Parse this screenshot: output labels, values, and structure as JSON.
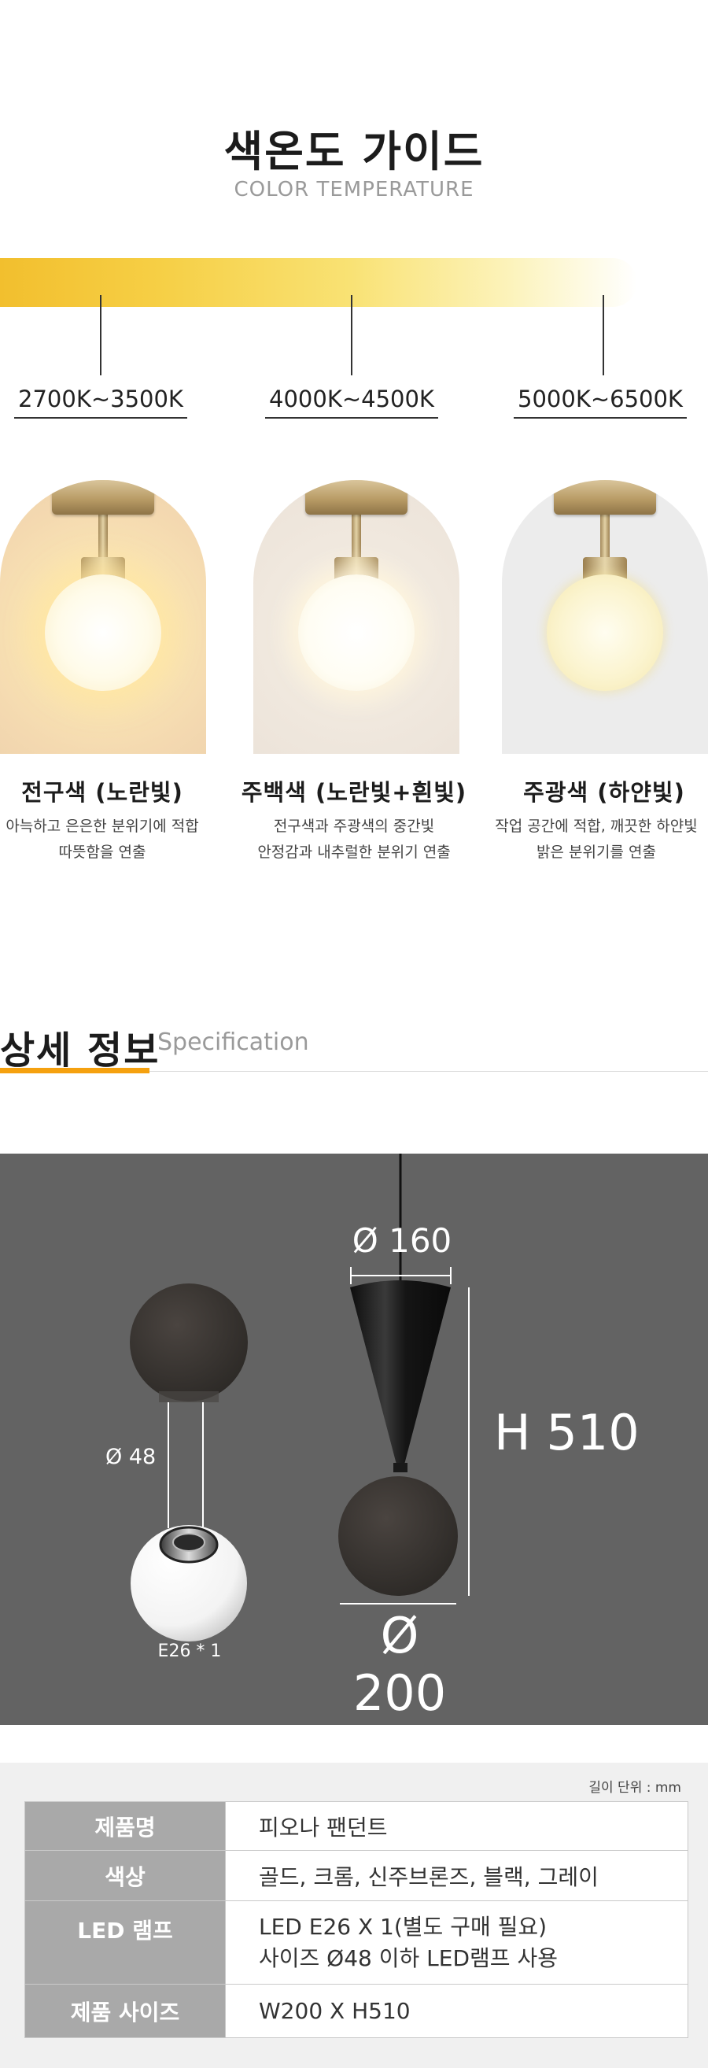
{
  "guide": {
    "title": "색온도 가이드",
    "subtitle": "COLOR TEMPERATURE",
    "ranges": [
      "2700K~3500K",
      "4000K~4500K",
      "5000K~6500K"
    ],
    "lamps": [
      {
        "name": "전구색 (노란빛)",
        "desc1": "아늑하고 은은한 분위기에 적합",
        "desc2": "따뜻함을 연출"
      },
      {
        "name": "주백색 (노란빛+흰빛)",
        "desc1": "전구색과 주광색의 중간빛",
        "desc2": "안정감과 내추럴한 분위기 연출"
      },
      {
        "name": "주광색 (하얀빛)",
        "desc1": "작업 공간에 적합, 깨끗한 하얀빛",
        "desc2": "밝은 분위기를 연출"
      }
    ]
  },
  "spec": {
    "title": "상세 정보",
    "title_en": "Specification",
    "accent_color": "#f5a10f",
    "dims": {
      "top_width": "Ø 160",
      "globe_width": "Ø 200",
      "height": "H 510",
      "socket": "Ø 48",
      "bulb": "E26 * 1"
    }
  },
  "table": {
    "unit_note": "길이 단위 : mm",
    "rows": [
      {
        "label": "제품명",
        "value": "피오나 팬던트"
      },
      {
        "label": "색상",
        "value": "골드, 크롬, 신주브론즈, 블랙, 그레이"
      },
      {
        "label": "LED 램프",
        "value": "LED E26 X 1(별도 구매 필요)",
        "value2": "사이즈 Ø48 이하 LED램프 사용"
      },
      {
        "label": "제품 사이즈",
        "value": "W200 X H510"
      }
    ]
  }
}
